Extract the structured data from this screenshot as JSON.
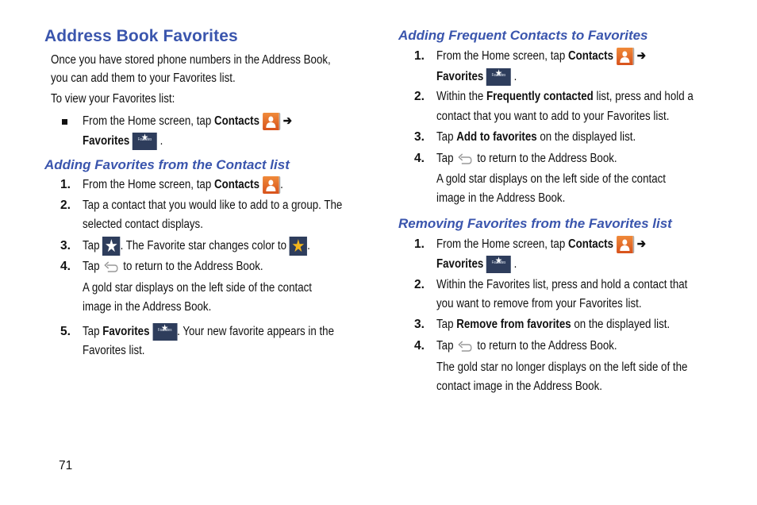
{
  "page": {
    "number": "71",
    "title": "Address Book Favorites",
    "intro": [
      "Once you have stored phone numbers in the Address Book,",
      "you can add them to your Favorites list."
    ],
    "view_label": "To view your Favorites list:",
    "bullet": {
      "pre": "From the Home screen, tap ",
      "contacts": "Contacts",
      "arrow": "➔",
      "favorites": "Favorites",
      "end": "."
    }
  },
  "icons": {
    "favorites_label": "Favorites",
    "star": "★"
  },
  "section_contact": {
    "title": "Adding Favorites from the Contact list",
    "steps": [
      {
        "n": "1.",
        "pre": "From the Home screen, tap ",
        "bold": "Contacts",
        "post": "."
      },
      {
        "n": "2.",
        "lines": [
          "Tap a contact that you would like to add to a group. The",
          "selected contact displays."
        ]
      },
      {
        "n": "3.",
        "pre": "Tap ",
        "mid": ". The Favorite star changes color to ",
        "post": "."
      },
      {
        "n": "4.",
        "pre": "Tap ",
        "post": " to return to the Address Book.",
        "note": [
          "A gold star displays on the left side of the contact",
          "image in the Address Book."
        ]
      },
      {
        "n": "5.",
        "pre": "Tap ",
        "bold": "Favorites",
        "post": ". Your new favorite appears in the",
        "line2": "Favorites list."
      }
    ]
  },
  "section_frequent": {
    "title": "Adding Frequent Contacts to Favorites",
    "steps": [
      {
        "n": "1.",
        "pre": "From the Home screen, tap ",
        "bold": "Contacts",
        "arrow": "➔",
        "bold2": "Favorites",
        "post": "."
      },
      {
        "n": "2.",
        "pre": "Within the ",
        "bold": "Frequently contacted",
        "post": " list, press and hold a",
        "line2": "contact that you want to add to your Favorites list."
      },
      {
        "n": "3.",
        "pre": "Tap ",
        "bold": "Add to favorites",
        "post": " on the displayed list."
      },
      {
        "n": "4.",
        "pre": "Tap ",
        "post": " to return to the Address Book.",
        "note": [
          "A gold star displays on the left side of the contact",
          "image in the Address Book."
        ]
      }
    ]
  },
  "section_remove": {
    "title": "Removing Favorites from the Favorites list",
    "steps": [
      {
        "n": "1.",
        "pre": "From the Home screen, tap ",
        "bold": "Contacts",
        "arrow": "➔",
        "bold2": "Favorites",
        "post": "."
      },
      {
        "n": "2.",
        "lines": [
          "Within the Favorites list, press and hold a contact that",
          "you want to remove from your Favorites list."
        ]
      },
      {
        "n": "3.",
        "pre": "Tap ",
        "bold": "Remove from favorites",
        "post": " on the displayed list."
      },
      {
        "n": "4.",
        "pre": "Tap ",
        "post": " to return to the Address Book.",
        "note": [
          "The gold star no longer displays on the left side of the",
          "contact image in the Address Book."
        ]
      }
    ]
  },
  "colors": {
    "heading": "#3a55ad",
    "contacts_icon": "#e0622a",
    "favorites_icon": "#2e3d5c",
    "gold_star": "#f2b51c"
  }
}
